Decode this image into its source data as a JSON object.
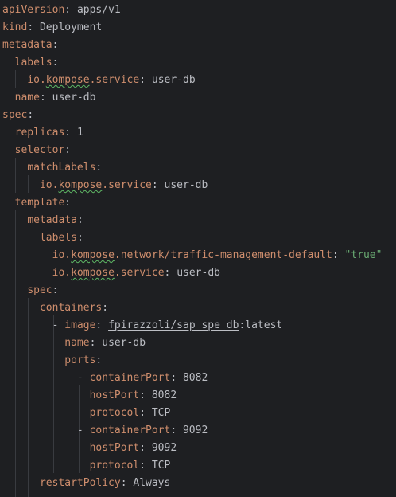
{
  "editor": {
    "lines": [
      {
        "key": "apiVersion",
        "sep": ": ",
        "value": "apps/v1"
      },
      {
        "key": "kind",
        "sep": ": ",
        "value": "Deployment"
      },
      {
        "key": "metadata",
        "sep": ":"
      },
      {
        "indent": "  ",
        "key": "labels",
        "sep": ":"
      },
      {
        "indent": "    ",
        "key_parts": [
          "io.",
          "kompose",
          ".service"
        ],
        "sep": ": ",
        "value": "user-db"
      },
      {
        "indent": "  ",
        "key": "name",
        "sep": ": ",
        "value": "user-db"
      },
      {
        "key": "spec",
        "sep": ":"
      },
      {
        "indent": "  ",
        "key": "replicas",
        "sep": ": ",
        "value": "1"
      },
      {
        "indent": "  ",
        "key": "selector",
        "sep": ":"
      },
      {
        "indent": "    ",
        "key": "matchLabels",
        "sep": ":"
      },
      {
        "indent": "      ",
        "key_parts": [
          "io.",
          "kompose",
          ".service"
        ],
        "sep": ": ",
        "value": "user-db"
      },
      {
        "indent": "  ",
        "key": "template",
        "sep": ":"
      },
      {
        "indent": "    ",
        "key": "metadata",
        "sep": ":"
      },
      {
        "indent": "      ",
        "key": "labels",
        "sep": ":"
      },
      {
        "indent": "        ",
        "key_parts": [
          "io.",
          "kompose",
          ".network/traffic-management-default"
        ],
        "sep": ": ",
        "value": "\"true\""
      },
      {
        "indent": "        ",
        "key_parts": [
          "io.",
          "kompose",
          ".service"
        ],
        "sep": ": ",
        "value": "user-db"
      },
      {
        "indent": "    ",
        "key": "spec",
        "sep": ":"
      },
      {
        "indent": "      ",
        "key": "containers",
        "sep": ":"
      },
      {
        "indent": "        ",
        "dash": "- ",
        "key": "image",
        "sep": ": ",
        "value_parts": [
          "fpirazzoli/sap_spe_db",
          ":latest"
        ]
      },
      {
        "indent": "          ",
        "key": "name",
        "sep": ": ",
        "value": "user-db"
      },
      {
        "indent": "          ",
        "key": "ports",
        "sep": ":"
      },
      {
        "indent": "            ",
        "dash": "- ",
        "key": "containerPort",
        "sep": ": ",
        "value": "8082"
      },
      {
        "indent": "              ",
        "key": "hostPort",
        "sep": ": ",
        "value": "8082"
      },
      {
        "indent": "              ",
        "key": "protocol",
        "sep": ": ",
        "value": "TCP"
      },
      {
        "indent": "            ",
        "dash": "- ",
        "key": "containerPort",
        "sep": ": ",
        "value": "9092"
      },
      {
        "indent": "              ",
        "key": "hostPort",
        "sep": ": ",
        "value": "9092"
      },
      {
        "indent": "              ",
        "key": "protocol",
        "sep": ": ",
        "value": "TCP"
      },
      {
        "indent": "      ",
        "key": "restartPolicy",
        "sep": ": ",
        "value": "Always"
      }
    ]
  },
  "colors": {
    "background": "#1e1f22",
    "key": "#cf8e6d",
    "text": "#bcbec4",
    "string": "#6aab73",
    "indent_guide": "#393b40",
    "typo_underline": "#5fb865"
  }
}
